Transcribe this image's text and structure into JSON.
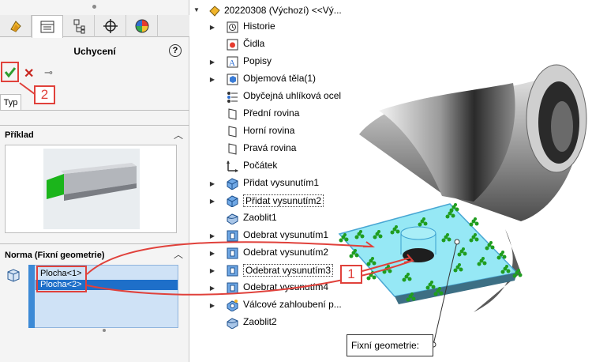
{
  "property_manager": {
    "title": "Uchycení",
    "help_glyph": "?",
    "tabs": [
      "feature-manager-icon",
      "property-manager-icon",
      "configuration-manager-icon",
      "dimxpert-icon",
      "display-manager-icon"
    ],
    "actions": {
      "ok": "✔",
      "cancel": "✕",
      "pin": "⊸"
    },
    "type_tab": "Typ",
    "callout_2": "2",
    "section_example": {
      "title": "Příklad"
    },
    "section_norm": {
      "title": "Norma (Fixní geometrie)",
      "selections": [
        "Plocha<1>",
        "Plocha<2>"
      ]
    },
    "colors": {
      "accent_red": "#e0413b",
      "selection_blue": "#1e6fc9",
      "list_bg": "#cfe2f6"
    }
  },
  "feature_tree": {
    "root": "20220308  (Výchozí) <<Vý...",
    "items": [
      {
        "label": "Historie",
        "icon": "history-icon",
        "expandable": true
      },
      {
        "label": "Čidla",
        "icon": "sensor-icon",
        "expandable": false
      },
      {
        "label": "Popisy",
        "icon": "annotations-icon",
        "expandable": true
      },
      {
        "label": "Objemová těla(1)",
        "icon": "solid-bodies-icon",
        "expandable": true
      },
      {
        "label": "Obyčejná uhlíková ocel",
        "icon": "material-icon",
        "expandable": false
      },
      {
        "label": "Přední rovina",
        "icon": "plane-icon",
        "expandable": false
      },
      {
        "label": "Horní rovina",
        "icon": "plane-icon",
        "expandable": false
      },
      {
        "label": "Pravá rovina",
        "icon": "plane-icon",
        "expandable": false
      },
      {
        "label": "Počátek",
        "icon": "origin-icon",
        "expandable": false
      },
      {
        "label": "Přidat vysunutím1",
        "icon": "extrude-boss-icon",
        "expandable": true
      },
      {
        "label": "Přidat vysunutím2",
        "icon": "extrude-boss-icon",
        "expandable": true
      },
      {
        "label": "Zaoblit1",
        "icon": "fillet-icon",
        "expandable": false
      },
      {
        "label": "Odebrat vysunutím1",
        "icon": "extrude-cut-icon",
        "expandable": true
      },
      {
        "label": "Odebrat vysunutím2",
        "icon": "extrude-cut-icon",
        "expandable": true
      },
      {
        "label": "Odebrat vysunutím3",
        "icon": "extrude-cut-icon",
        "expandable": true
      },
      {
        "label": "Odebrat vysunutím4",
        "icon": "extrude-cut-icon",
        "expandable": true
      },
      {
        "label": "Válcové zahloubení p...",
        "icon": "hole-wizard-icon",
        "expandable": true
      },
      {
        "label": "Zaoblit2",
        "icon": "fillet-icon",
        "expandable": false
      }
    ]
  },
  "viewport": {
    "callout_1": "1",
    "fixed_geometry_label": "Fixní geometrie:"
  }
}
